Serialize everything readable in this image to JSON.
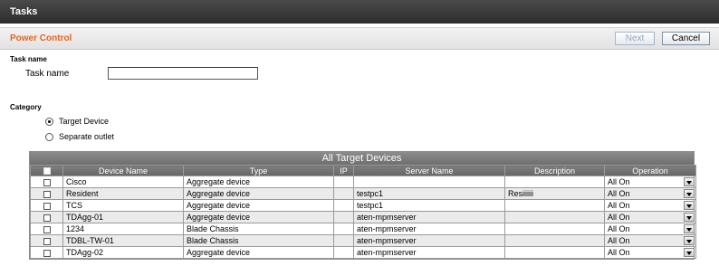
{
  "window": {
    "title": "Tasks"
  },
  "header": {
    "page_title": "Power Control",
    "next_label": "Next",
    "cancel_label": "Cancel"
  },
  "task_name": {
    "section_title": "Task name",
    "field_label": "Task name",
    "value": ""
  },
  "category": {
    "section_title": "Category",
    "options": [
      {
        "label": "Target Device",
        "selected": true
      },
      {
        "label": "Separate outlet",
        "selected": false
      }
    ]
  },
  "devices": {
    "title": "All Target Devices",
    "columns": [
      "",
      "Device Name",
      "Type",
      "IP",
      "Server Name",
      "Description",
      "Operation"
    ],
    "rows": [
      {
        "name": "Cisco",
        "type": "Aggregate device",
        "ip": "",
        "server": "",
        "description": "",
        "operation": "All On"
      },
      {
        "name": "Resident",
        "type": "Aggregate device",
        "ip": "",
        "server": "testpc1",
        "description": "Resiiiiii",
        "operation": "All On"
      },
      {
        "name": "TCS",
        "type": "Aggregate device",
        "ip": "",
        "server": "testpc1",
        "description": "",
        "operation": "All On"
      },
      {
        "name": "TDAgg-01",
        "type": "Aggregate device",
        "ip": "",
        "server": "aten-mpmserver",
        "description": "",
        "operation": "All On"
      },
      {
        "name": "1234",
        "type": "Blade Chassis",
        "ip": "",
        "server": "aten-mpmserver",
        "description": "",
        "operation": "All On"
      },
      {
        "name": "TDBL-TW-01",
        "type": "Blade Chassis",
        "ip": "",
        "server": "aten-mpmserver",
        "description": "",
        "operation": "All On"
      },
      {
        "name": "TDAgg-02",
        "type": "Aggregate device",
        "ip": "",
        "server": "aten-mpmserver",
        "description": "",
        "operation": "All On"
      }
    ]
  }
}
